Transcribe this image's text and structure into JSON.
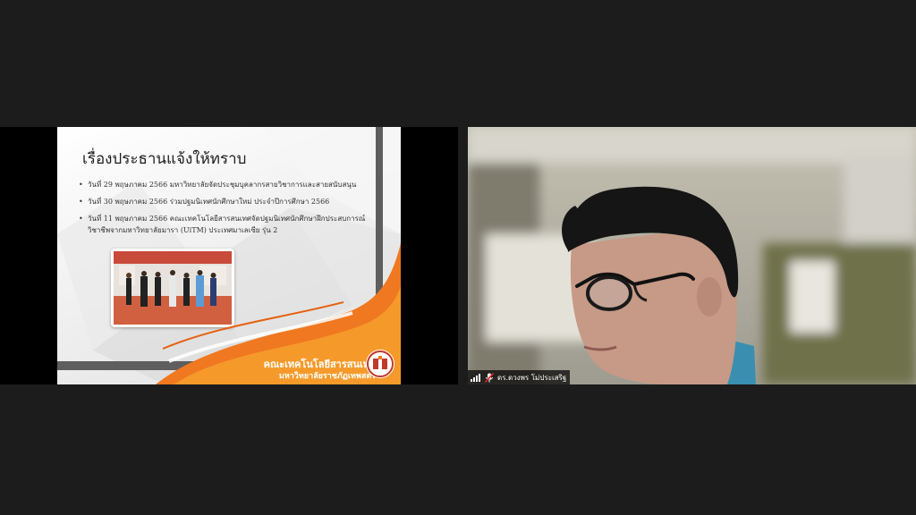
{
  "slide": {
    "title": "เรื่องประธานแจ้งให้ทราบ",
    "bullets": [
      "วันที่ 29 พฤษภาคม 2566 มหาวิทยาลัยจัดประชุมบุคลากรสายวิชาการและสายสนับสนุน",
      "วันที่ 30 พฤษภาคม 2566 ร่วมปฐมนิเทศนักศึกษาใหม่ ประจำปีการศึกษา 2566",
      "วันที่ 11 พฤษภาคม 2566 คณะเทคโนโลยีสารสนเทศจัดปฐมนิเทศนักศึกษาฝึกประสบการณ์วิชาชีพจากมหาวิทยาลัยมารา (UiTM) ประเทศมาเลเซีย รุ่น 2"
    ],
    "faculty_name": "คณะเทคโนโลยีสารสนเทศ",
    "university_name": "มหาวิทยาลัยราชภัฏเทพสตรี",
    "accent_color": "#f07820"
  },
  "participant": {
    "name": "ดร.ดวงพร โม่ประเสริฐ",
    "signal_icon": "signal-bars-icon",
    "mic_icon": "mic-muted-icon"
  }
}
